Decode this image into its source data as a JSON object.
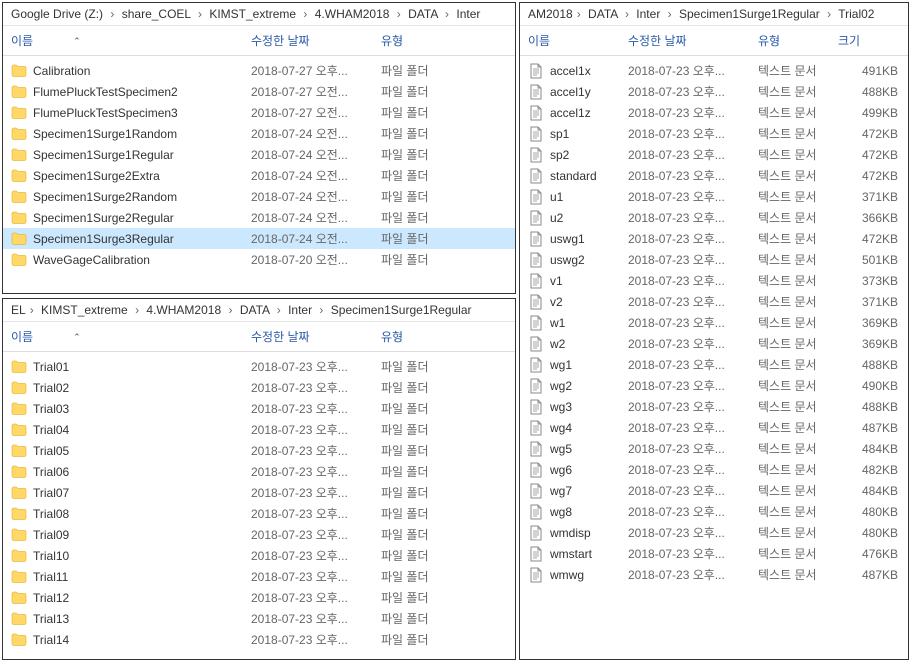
{
  "headers": {
    "name": "이름",
    "date": "수정한 날짜",
    "type": "유형",
    "size": "크기"
  },
  "types": {
    "folder": "파일 폴더",
    "text": "텍스트 문서"
  },
  "panel1": {
    "breadcrumb": [
      "Google Drive (Z:)",
      "share_COEL",
      "KIMST_extreme",
      "4.WHAM2018",
      "DATA",
      "Inter"
    ],
    "selected": "Specimen1Surge3Regular",
    "items": [
      {
        "name": "Calibration",
        "date": "2018-07-27 오후..."
      },
      {
        "name": "FlumePluckTestSpecimen2",
        "date": "2018-07-27 오전..."
      },
      {
        "name": "FlumePluckTestSpecimen3",
        "date": "2018-07-27 오전..."
      },
      {
        "name": "Specimen1Surge1Random",
        "date": "2018-07-24 오전..."
      },
      {
        "name": "Specimen1Surge1Regular",
        "date": "2018-07-24 오전..."
      },
      {
        "name": "Specimen1Surge2Extra",
        "date": "2018-07-24 오전..."
      },
      {
        "name": "Specimen1Surge2Random",
        "date": "2018-07-24 오전..."
      },
      {
        "name": "Specimen1Surge2Regular",
        "date": "2018-07-24 오전..."
      },
      {
        "name": "Specimen1Surge3Regular",
        "date": "2018-07-24 오전..."
      },
      {
        "name": "WaveGageCalibration",
        "date": "2018-07-20 오전..."
      }
    ]
  },
  "panel2": {
    "breadcrumb_prefix": "EL",
    "breadcrumb": [
      "KIMST_extreme",
      "4.WHAM2018",
      "DATA",
      "Inter",
      "Specimen1Surge1Regular"
    ],
    "items": [
      {
        "name": "Trial01",
        "date": "2018-07-23 오후..."
      },
      {
        "name": "Trial02",
        "date": "2018-07-23 오후..."
      },
      {
        "name": "Trial03",
        "date": "2018-07-23 오후..."
      },
      {
        "name": "Trial04",
        "date": "2018-07-23 오후..."
      },
      {
        "name": "Trial05",
        "date": "2018-07-23 오후..."
      },
      {
        "name": "Trial06",
        "date": "2018-07-23 오후..."
      },
      {
        "name": "Trial07",
        "date": "2018-07-23 오후..."
      },
      {
        "name": "Trial08",
        "date": "2018-07-23 오후..."
      },
      {
        "name": "Trial09",
        "date": "2018-07-23 오후..."
      },
      {
        "name": "Trial10",
        "date": "2018-07-23 오후..."
      },
      {
        "name": "Trial11",
        "date": "2018-07-23 오후..."
      },
      {
        "name": "Trial12",
        "date": "2018-07-23 오후..."
      },
      {
        "name": "Trial13",
        "date": "2018-07-23 오후..."
      },
      {
        "name": "Trial14",
        "date": "2018-07-23 오후..."
      }
    ]
  },
  "panel3": {
    "breadcrumb_prefix": "AM2018",
    "breadcrumb": [
      "DATA",
      "Inter",
      "Specimen1Surge1Regular",
      "Trial02"
    ],
    "items": [
      {
        "name": "accel1x",
        "date": "2018-07-23 오후...",
        "size": "491KB"
      },
      {
        "name": "accel1y",
        "date": "2018-07-23 오후...",
        "size": "488KB"
      },
      {
        "name": "accel1z",
        "date": "2018-07-23 오후...",
        "size": "499KB"
      },
      {
        "name": "sp1",
        "date": "2018-07-23 오후...",
        "size": "472KB"
      },
      {
        "name": "sp2",
        "date": "2018-07-23 오후...",
        "size": "472KB"
      },
      {
        "name": "standard",
        "date": "2018-07-23 오후...",
        "size": "472KB"
      },
      {
        "name": "u1",
        "date": "2018-07-23 오후...",
        "size": "371KB"
      },
      {
        "name": "u2",
        "date": "2018-07-23 오후...",
        "size": "366KB"
      },
      {
        "name": "uswg1",
        "date": "2018-07-23 오후...",
        "size": "472KB"
      },
      {
        "name": "uswg2",
        "date": "2018-07-23 오후...",
        "size": "501KB"
      },
      {
        "name": "v1",
        "date": "2018-07-23 오후...",
        "size": "373KB"
      },
      {
        "name": "v2",
        "date": "2018-07-23 오후...",
        "size": "371KB"
      },
      {
        "name": "w1",
        "date": "2018-07-23 오후...",
        "size": "369KB"
      },
      {
        "name": "w2",
        "date": "2018-07-23 오후...",
        "size": "369KB"
      },
      {
        "name": "wg1",
        "date": "2018-07-23 오후...",
        "size": "488KB"
      },
      {
        "name": "wg2",
        "date": "2018-07-23 오후...",
        "size": "490KB"
      },
      {
        "name": "wg3",
        "date": "2018-07-23 오후...",
        "size": "488KB"
      },
      {
        "name": "wg4",
        "date": "2018-07-23 오후...",
        "size": "487KB"
      },
      {
        "name": "wg5",
        "date": "2018-07-23 오후...",
        "size": "484KB"
      },
      {
        "name": "wg6",
        "date": "2018-07-23 오후...",
        "size": "482KB"
      },
      {
        "name": "wg7",
        "date": "2018-07-23 오후...",
        "size": "484KB"
      },
      {
        "name": "wg8",
        "date": "2018-07-23 오후...",
        "size": "480KB"
      },
      {
        "name": "wmdisp",
        "date": "2018-07-23 오후...",
        "size": "480KB"
      },
      {
        "name": "wmstart",
        "date": "2018-07-23 오후...",
        "size": "476KB"
      },
      {
        "name": "wmwg",
        "date": "2018-07-23 오후...",
        "size": "487KB"
      }
    ]
  }
}
